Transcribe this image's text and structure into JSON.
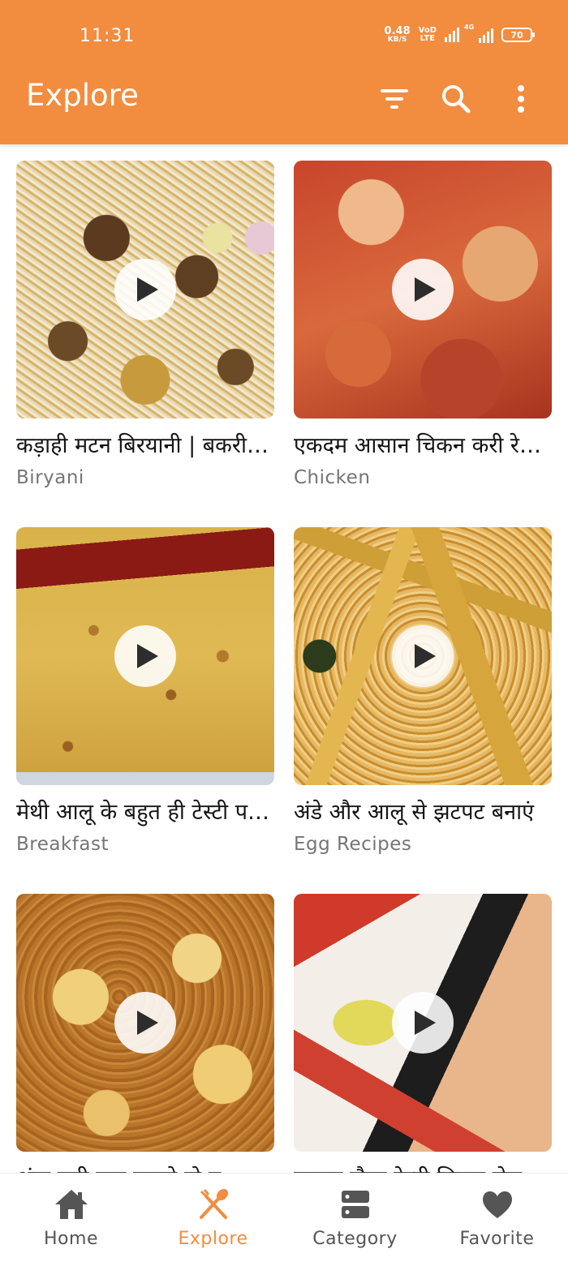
{
  "status_bar": {
    "time": "11:31",
    "net_speed_value": "0.48",
    "net_speed_unit": "KB/S",
    "volte_top": "VoD",
    "volte_bottom": "LTE",
    "network_tag": "4G",
    "battery": "70"
  },
  "header": {
    "title": "Explore",
    "background_color": "#F28C3F",
    "actions": [
      "filter-icon",
      "search-icon",
      "more-vert-icon"
    ]
  },
  "videos": [
    {
      "title": "कड़ाही मटन बिरयानी | बकरीद स्पेशल",
      "category": "Biryani"
    },
    {
      "title": "एकदम आसान चिकन करी रेसिपी",
      "category": "Chicken"
    },
    {
      "title": "मेथी आलू के बहुत ही टेस्टी पराठे",
      "category": "Breakfast"
    },
    {
      "title": "अंडे और आलू से झटपट बनाएं",
      "category": "Egg Recipes"
    },
    {
      "title": "अंडा करी बना सकते हो ब",
      "category": ""
    },
    {
      "title": "बाजार जैसा टेस्टी चिकन रोल",
      "category": ""
    }
  ],
  "bottom_nav": {
    "items": [
      {
        "label": "Home",
        "icon": "home-icon"
      },
      {
        "label": "Explore",
        "icon": "explore-icon"
      },
      {
        "label": "Category",
        "icon": "category-icon"
      },
      {
        "label": "Favorite",
        "icon": "heart-icon"
      }
    ],
    "active": "Explore",
    "active_color": "#F28C3F",
    "inactive_color": "#555555"
  }
}
